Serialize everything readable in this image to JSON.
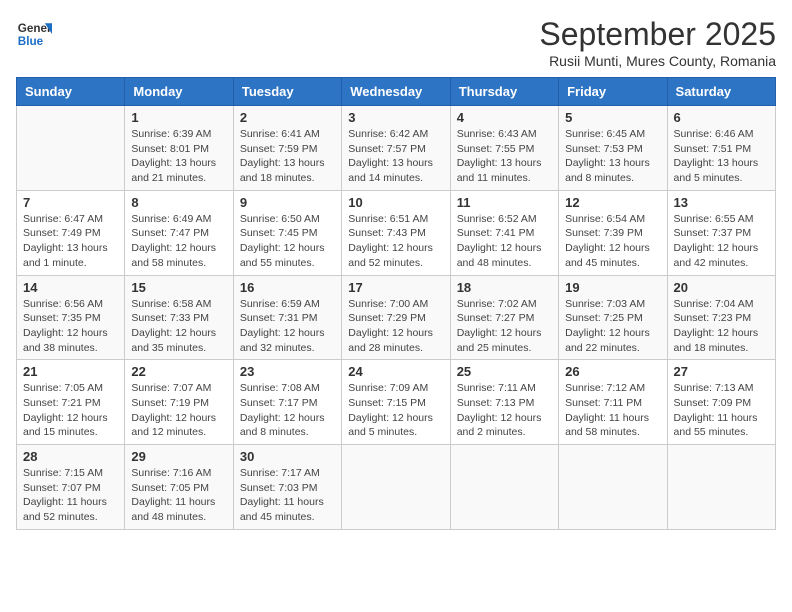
{
  "logo": {
    "line1": "General",
    "line2": "Blue"
  },
  "title": "September 2025",
  "subtitle": "Rusii Munti, Mures County, Romania",
  "weekdays": [
    "Sunday",
    "Monday",
    "Tuesday",
    "Wednesday",
    "Thursday",
    "Friday",
    "Saturday"
  ],
  "weeks": [
    [
      {
        "day": "",
        "info": ""
      },
      {
        "day": "1",
        "info": "Sunrise: 6:39 AM\nSunset: 8:01 PM\nDaylight: 13 hours and 21 minutes."
      },
      {
        "day": "2",
        "info": "Sunrise: 6:41 AM\nSunset: 7:59 PM\nDaylight: 13 hours and 18 minutes."
      },
      {
        "day": "3",
        "info": "Sunrise: 6:42 AM\nSunset: 7:57 PM\nDaylight: 13 hours and 14 minutes."
      },
      {
        "day": "4",
        "info": "Sunrise: 6:43 AM\nSunset: 7:55 PM\nDaylight: 13 hours and 11 minutes."
      },
      {
        "day": "5",
        "info": "Sunrise: 6:45 AM\nSunset: 7:53 PM\nDaylight: 13 hours and 8 minutes."
      },
      {
        "day": "6",
        "info": "Sunrise: 6:46 AM\nSunset: 7:51 PM\nDaylight: 13 hours and 5 minutes."
      }
    ],
    [
      {
        "day": "7",
        "info": "Sunrise: 6:47 AM\nSunset: 7:49 PM\nDaylight: 13 hours and 1 minute."
      },
      {
        "day": "8",
        "info": "Sunrise: 6:49 AM\nSunset: 7:47 PM\nDaylight: 12 hours and 58 minutes."
      },
      {
        "day": "9",
        "info": "Sunrise: 6:50 AM\nSunset: 7:45 PM\nDaylight: 12 hours and 55 minutes."
      },
      {
        "day": "10",
        "info": "Sunrise: 6:51 AM\nSunset: 7:43 PM\nDaylight: 12 hours and 52 minutes."
      },
      {
        "day": "11",
        "info": "Sunrise: 6:52 AM\nSunset: 7:41 PM\nDaylight: 12 hours and 48 minutes."
      },
      {
        "day": "12",
        "info": "Sunrise: 6:54 AM\nSunset: 7:39 PM\nDaylight: 12 hours and 45 minutes."
      },
      {
        "day": "13",
        "info": "Sunrise: 6:55 AM\nSunset: 7:37 PM\nDaylight: 12 hours and 42 minutes."
      }
    ],
    [
      {
        "day": "14",
        "info": "Sunrise: 6:56 AM\nSunset: 7:35 PM\nDaylight: 12 hours and 38 minutes."
      },
      {
        "day": "15",
        "info": "Sunrise: 6:58 AM\nSunset: 7:33 PM\nDaylight: 12 hours and 35 minutes."
      },
      {
        "day": "16",
        "info": "Sunrise: 6:59 AM\nSunset: 7:31 PM\nDaylight: 12 hours and 32 minutes."
      },
      {
        "day": "17",
        "info": "Sunrise: 7:00 AM\nSunset: 7:29 PM\nDaylight: 12 hours and 28 minutes."
      },
      {
        "day": "18",
        "info": "Sunrise: 7:02 AM\nSunset: 7:27 PM\nDaylight: 12 hours and 25 minutes."
      },
      {
        "day": "19",
        "info": "Sunrise: 7:03 AM\nSunset: 7:25 PM\nDaylight: 12 hours and 22 minutes."
      },
      {
        "day": "20",
        "info": "Sunrise: 7:04 AM\nSunset: 7:23 PM\nDaylight: 12 hours and 18 minutes."
      }
    ],
    [
      {
        "day": "21",
        "info": "Sunrise: 7:05 AM\nSunset: 7:21 PM\nDaylight: 12 hours and 15 minutes."
      },
      {
        "day": "22",
        "info": "Sunrise: 7:07 AM\nSunset: 7:19 PM\nDaylight: 12 hours and 12 minutes."
      },
      {
        "day": "23",
        "info": "Sunrise: 7:08 AM\nSunset: 7:17 PM\nDaylight: 12 hours and 8 minutes."
      },
      {
        "day": "24",
        "info": "Sunrise: 7:09 AM\nSunset: 7:15 PM\nDaylight: 12 hours and 5 minutes."
      },
      {
        "day": "25",
        "info": "Sunrise: 7:11 AM\nSunset: 7:13 PM\nDaylight: 12 hours and 2 minutes."
      },
      {
        "day": "26",
        "info": "Sunrise: 7:12 AM\nSunset: 7:11 PM\nDaylight: 11 hours and 58 minutes."
      },
      {
        "day": "27",
        "info": "Sunrise: 7:13 AM\nSunset: 7:09 PM\nDaylight: 11 hours and 55 minutes."
      }
    ],
    [
      {
        "day": "28",
        "info": "Sunrise: 7:15 AM\nSunset: 7:07 PM\nDaylight: 11 hours and 52 minutes."
      },
      {
        "day": "29",
        "info": "Sunrise: 7:16 AM\nSunset: 7:05 PM\nDaylight: 11 hours and 48 minutes."
      },
      {
        "day": "30",
        "info": "Sunrise: 7:17 AM\nSunset: 7:03 PM\nDaylight: 11 hours and 45 minutes."
      },
      {
        "day": "",
        "info": ""
      },
      {
        "day": "",
        "info": ""
      },
      {
        "day": "",
        "info": ""
      },
      {
        "day": "",
        "info": ""
      }
    ]
  ]
}
